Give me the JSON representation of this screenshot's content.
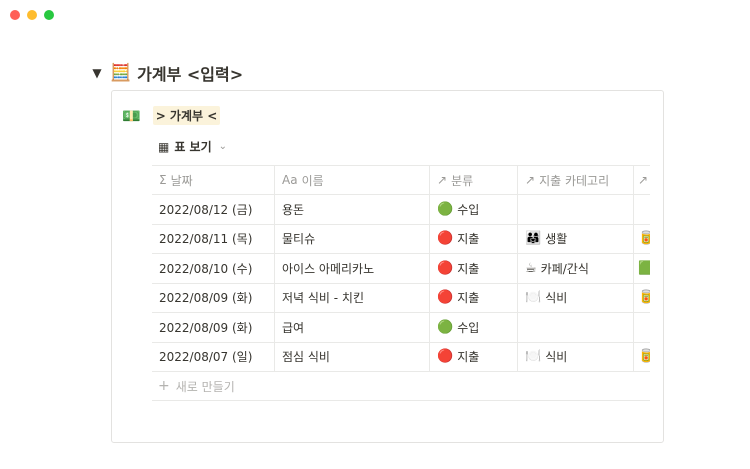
{
  "window": {
    "controls": [
      {
        "name": "close",
        "color": "#ff5f57"
      },
      {
        "name": "minimize",
        "color": "#febc2e"
      },
      {
        "name": "zoom",
        "color": "#28c840"
      }
    ]
  },
  "toggle": {
    "arrow": "▼",
    "icon": "🧮",
    "title": "가계부 <입력>"
  },
  "database": {
    "icon": "💵",
    "title": "> 가계부 <"
  },
  "view": {
    "icon": "▦",
    "label": "표 보기",
    "chevron": "⌄"
  },
  "table": {
    "columns": [
      {
        "icon": "Σ",
        "label": "날짜"
      },
      {
        "icon": "Aa",
        "label": "이름"
      },
      {
        "icon": "↗",
        "label": "분류"
      },
      {
        "icon": "↗",
        "label": "지출 카테고리"
      },
      {
        "icon": "↗",
        "label": ""
      }
    ],
    "rows": [
      {
        "date": "2022/08/12 (금)",
        "name": "용돈",
        "type_icon": "🟢",
        "type": "수입",
        "cat_icon": "",
        "cat": "",
        "extra": ""
      },
      {
        "date": "2022/08/11 (목)",
        "name": "물티슈",
        "type_icon": "🔴",
        "type": "지출",
        "cat_icon": "👨‍👩‍👧",
        "cat": "생활",
        "extra": "🥫"
      },
      {
        "date": "2022/08/10 (수)",
        "name": "아이스 아메리카노",
        "type_icon": "🔴",
        "type": "지출",
        "cat_icon": "☕",
        "cat": "카페/간식",
        "extra": "🟩"
      },
      {
        "date": "2022/08/09 (화)",
        "name": "저녁 식비 - 치킨",
        "type_icon": "🔴",
        "type": "지출",
        "cat_icon": "🍽️",
        "cat": "식비",
        "extra": "🥫"
      },
      {
        "date": "2022/08/09 (화)",
        "name": "급여",
        "type_icon": "🟢",
        "type": "수입",
        "cat_icon": "",
        "cat": "",
        "extra": ""
      },
      {
        "date": "2022/08/07 (일)",
        "name": "점심 식비",
        "type_icon": "🔴",
        "type": "지출",
        "cat_icon": "🍽️",
        "cat": "식비",
        "extra": "🥫"
      }
    ],
    "new_row": {
      "icon": "+",
      "label": "새로 만들기"
    }
  }
}
